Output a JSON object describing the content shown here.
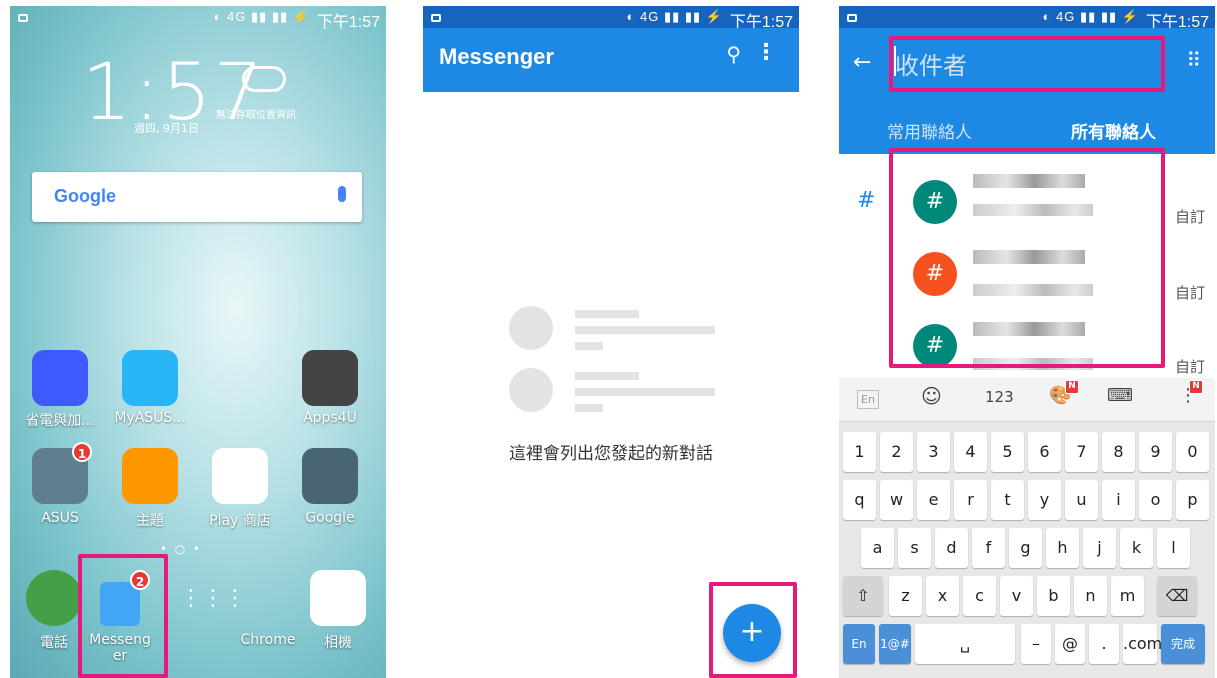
{
  "status": {
    "time": "下午1:57",
    "icons": "◐ 4G ▮▮ ▮▮ ⚡"
  },
  "home": {
    "clock": "1:57",
    "weather_note": "無法存取位置資訊",
    "date": "週四, 9月1日",
    "google_label": "Google",
    "apps": [
      {
        "label": "省電與加...",
        "color": "#3d5afe"
      },
      {
        "label": "MyASUS...",
        "color": "#29b6f6"
      },
      {
        "label": "Apps4U",
        "color": "#444"
      },
      {
        "label": "ASUS",
        "color": "#5f7f8f",
        "badge": "1"
      },
      {
        "label": "主題",
        "color": "#ff9800"
      },
      {
        "label": "Play 商店",
        "color": "#ffffff"
      },
      {
        "label": "Google",
        "color": "#4a6572"
      }
    ],
    "dock": [
      {
        "label": "電話",
        "color": "#43a047"
      },
      {
        "label": "Messeng\ner",
        "color": "#42a5f5",
        "badge": "2"
      },
      {
        "label": "",
        "color": "transparent"
      },
      {
        "label": "Chrome",
        "color": "#ffffff"
      },
      {
        "label": "相機",
        "color": "#1e88e5"
      }
    ]
  },
  "messenger": {
    "title": "Messenger",
    "empty_text": "這裡會列出您發起的新對話",
    "fab": "+"
  },
  "compose": {
    "placeholder": "收件者",
    "tab_frequent": "常用聯絡人",
    "tab_all": "所有聯絡人",
    "section": "#",
    "contacts": [
      {
        "avatar": "#",
        "color": "#00897b",
        "label": "自訂"
      },
      {
        "avatar": "#",
        "color": "#f4511e",
        "label": "自訂"
      },
      {
        "avatar": "#",
        "color": "#00897b",
        "label": "自訂"
      }
    ],
    "kb_toolbar": [
      "En",
      "☺",
      "123",
      "🎨",
      "⌨",
      "⋮"
    ],
    "kb_badges": [
      "N",
      "N"
    ],
    "row_nums": [
      "1",
      "2",
      "3",
      "4",
      "5",
      "6",
      "7",
      "8",
      "9",
      "0"
    ],
    "row_q": [
      "q",
      "w",
      "e",
      "r",
      "t",
      "y",
      "u",
      "i",
      "o",
      "p"
    ],
    "row_a": [
      "a",
      "s",
      "d",
      "f",
      "g",
      "h",
      "j",
      "k",
      "l"
    ],
    "row_z": [
      "⇧",
      "z",
      "x",
      "c",
      "v",
      "b",
      "n",
      "m",
      "⌫"
    ],
    "row_bottom": [
      "En",
      "1@#",
      "␣",
      "–",
      "@",
      ".",
      ".com",
      "完成"
    ]
  }
}
